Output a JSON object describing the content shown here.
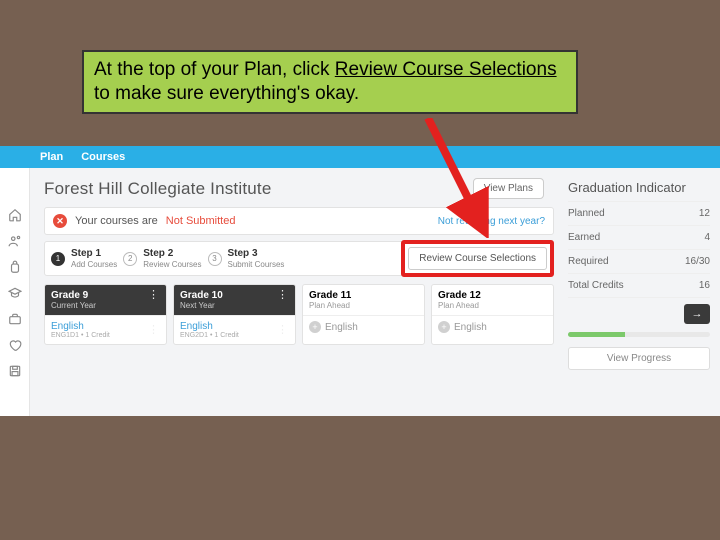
{
  "callout": {
    "prefix": "At the top of your Plan, click ",
    "emph": "Review Course Selections",
    "suffix": " to make sure everything's okay."
  },
  "topbar": {
    "tab_plan": "Plan",
    "tab_courses": "Courses"
  },
  "school": {
    "name": "Forest Hill Collegiate Institute",
    "view_plans": "View Plans"
  },
  "status": {
    "prefix": "Your courses are ",
    "state": "Not Submitted",
    "not_returning": "Not returning next year?"
  },
  "steps": {
    "s1": {
      "label": "Step 1",
      "sub": "Add Courses"
    },
    "s2": {
      "label": "Step 2",
      "sub": "Review Courses"
    },
    "s3": {
      "label": "Step 3",
      "sub": "Submit Courses"
    },
    "review_btn": "Review Course Selections"
  },
  "grades": [
    {
      "title": "Grade 9",
      "sub": "Current Year",
      "course": "English",
      "code": "ENG1D1 • 1 Credit",
      "style": "dark"
    },
    {
      "title": "Grade 10",
      "sub": "Next Year",
      "course": "English",
      "code": "ENG2D1 • 1 Credit",
      "style": "dark"
    },
    {
      "title": "Grade 11",
      "sub": "Plan Ahead",
      "course": "English",
      "style": "light",
      "add": true
    },
    {
      "title": "Grade 12",
      "sub": "Plan Ahead",
      "course": "English",
      "style": "light",
      "add": true
    }
  ],
  "indicator": {
    "title": "Graduation Indicator",
    "rows": [
      {
        "label": "Planned",
        "value": "12"
      },
      {
        "label": "Earned",
        "value": "4"
      },
      {
        "label": "Required",
        "value": "16/30"
      },
      {
        "label": "Total Credits",
        "value": "16"
      }
    ],
    "view_progress": "View Progress"
  },
  "colors": {
    "accent_blue": "#2aafe6",
    "danger": "#e74c3c",
    "highlight_red": "#e3211f",
    "callout_bg": "#a5cf4f"
  }
}
